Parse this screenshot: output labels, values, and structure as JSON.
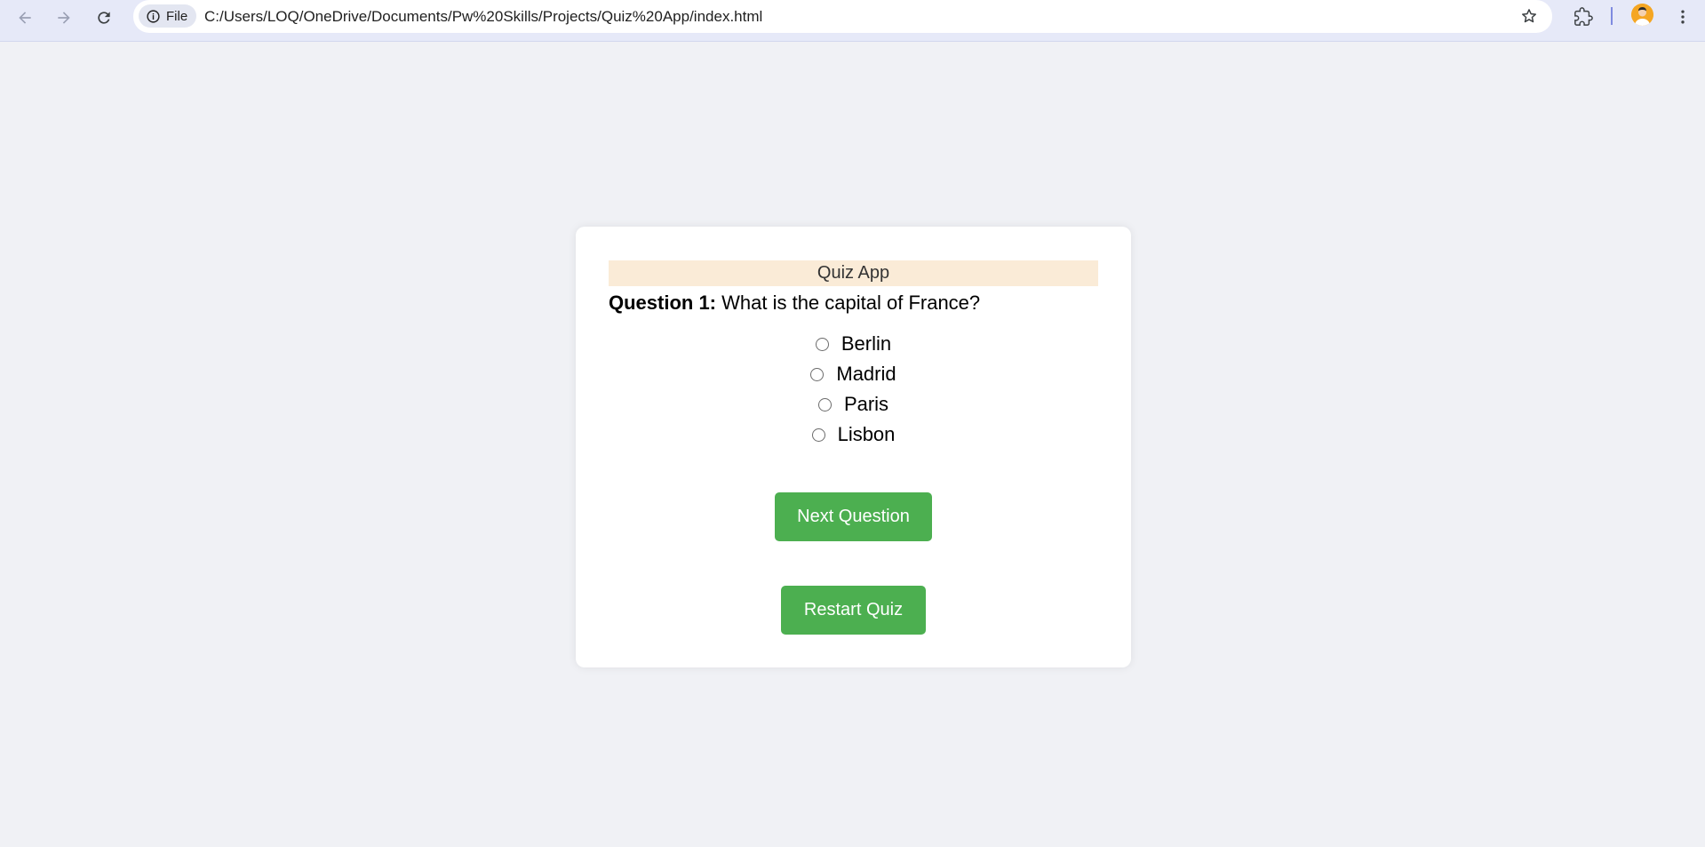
{
  "browser": {
    "site_chip_label": "File",
    "url": "C:/Users/LOQ/OneDrive/Documents/Pw%20Skills/Projects/Quiz%20App/index.html",
    "icons": {
      "back": "arrow-left-icon",
      "forward": "arrow-right-icon",
      "reload": "reload-icon",
      "info": "info-icon",
      "bookmark": "star-icon",
      "extensions": "puzzle-icon",
      "profile": "avatar",
      "menu": "kebab-menu-icon"
    }
  },
  "quiz": {
    "title": "Quiz App",
    "question_number_label": "Question 1:",
    "question_text": " What is the capital of France?",
    "options": [
      {
        "label": "Berlin",
        "checked": false
      },
      {
        "label": "Madrid",
        "checked": false
      },
      {
        "label": "Paris",
        "checked": false
      },
      {
        "label": "Lisbon",
        "checked": false
      }
    ],
    "next_button_label": "Next Question",
    "restart_button_label": "Restart Quiz"
  },
  "colors": {
    "page_background": "#f0f1f5",
    "title_background": "#faebd7",
    "button_green": "#4caf50",
    "browser_bar": "#e6e9f8"
  }
}
